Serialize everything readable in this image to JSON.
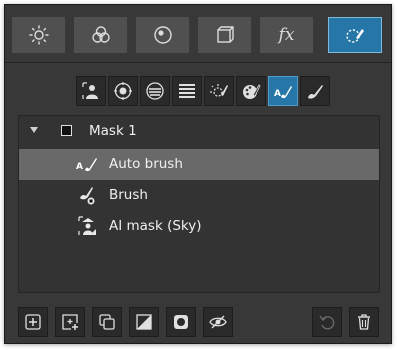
{
  "top_tabs": [
    {
      "icon": "sun-icon"
    },
    {
      "icon": "color-circles-icon"
    },
    {
      "icon": "detail-icon"
    },
    {
      "icon": "lens-cube-icon"
    },
    {
      "icon": "fx-icon",
      "label": "fx"
    },
    {
      "icon": "masking-brush-icon",
      "active": true
    }
  ],
  "mask_tools": [
    {
      "icon": "ai-subject-icon"
    },
    {
      "icon": "radial-gradient-icon"
    },
    {
      "icon": "linear-gradient-icon"
    },
    {
      "icon": "stripes-icon"
    },
    {
      "icon": "luminance-range-icon"
    },
    {
      "icon": "color-range-icon"
    },
    {
      "icon": "auto-brush-icon",
      "active": true
    },
    {
      "icon": "brush-icon"
    }
  ],
  "mask_list": {
    "group": {
      "label": "Mask 1",
      "expanded": true
    },
    "items": [
      {
        "label": "Auto brush",
        "icon": "auto-brush-icon",
        "selected": true
      },
      {
        "label": "Brush",
        "icon": "brush-subtract-icon"
      },
      {
        "label": "AI mask (Sky)",
        "icon": "ai-sky-icon"
      }
    ],
    "auto_brush_icon_text": "A"
  },
  "bottom_buttons": [
    {
      "icon": "add-mask-icon"
    },
    {
      "icon": "new-mask-icon"
    },
    {
      "icon": "duplicate-icon"
    },
    {
      "icon": "invert-icon"
    },
    {
      "icon": "show-mask-icon"
    },
    {
      "icon": "overlay-eye-icon"
    },
    {
      "icon": "undo-icon",
      "disabled": true
    },
    {
      "icon": "trash-icon"
    }
  ],
  "colors": {
    "accent": "#2677a8",
    "panel": "#383838",
    "selected_row": "#696969"
  }
}
